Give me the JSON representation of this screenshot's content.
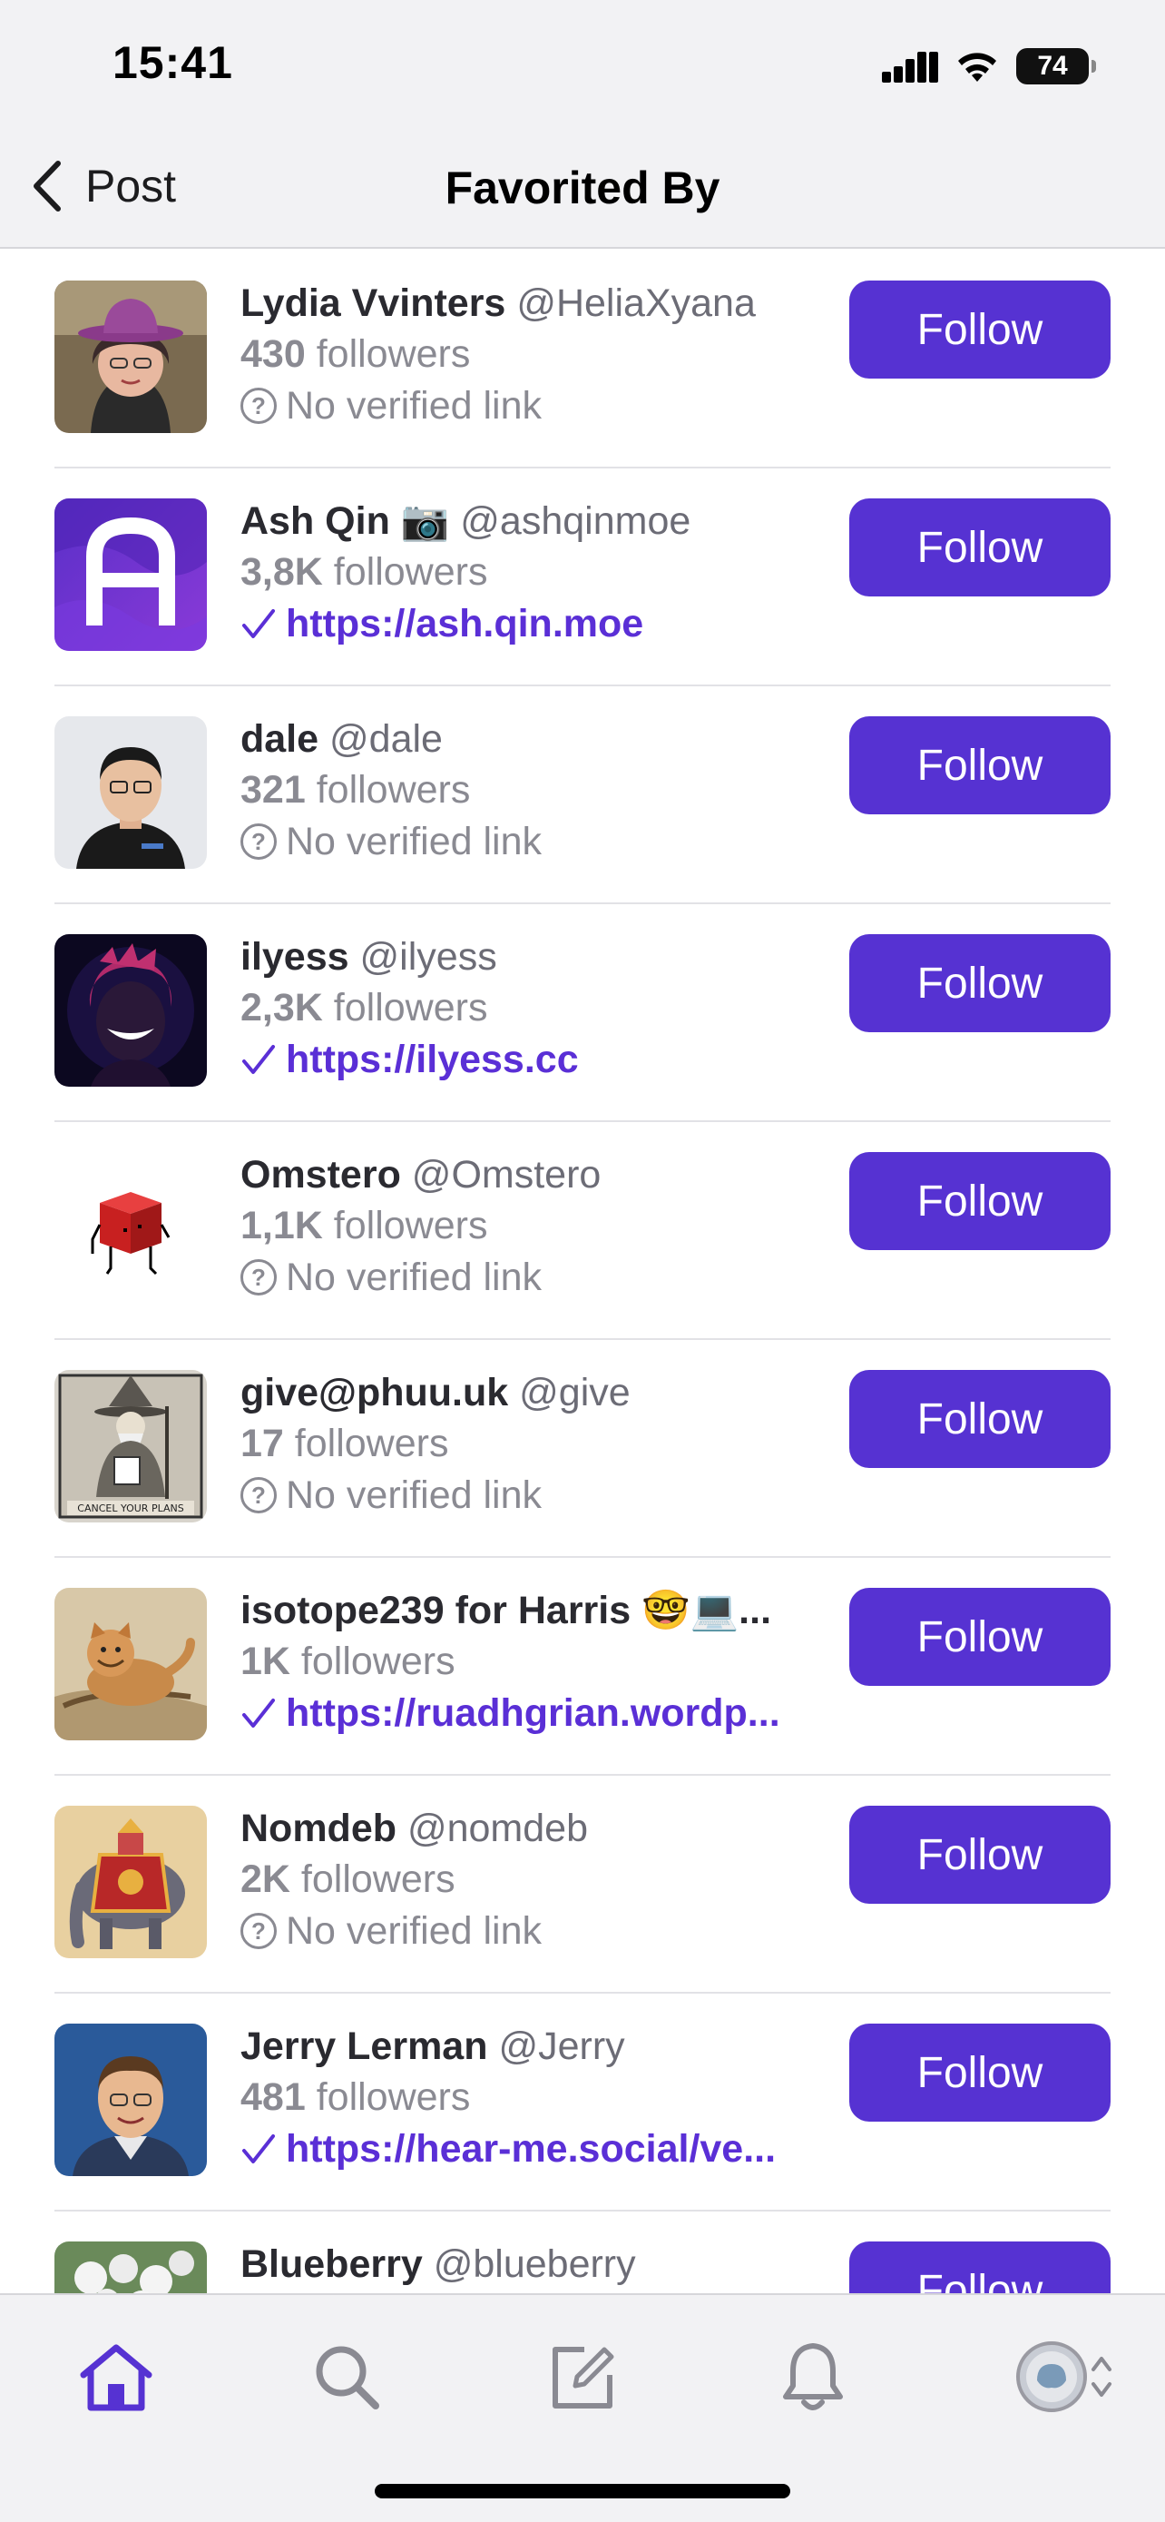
{
  "status_bar": {
    "time": "15:41",
    "battery": "74"
  },
  "nav": {
    "back_label": "Post",
    "title": "Favorited By"
  },
  "follow_label": "Follow",
  "followers_suffix": "followers",
  "users": [
    {
      "name": "Lydia Vvinters",
      "handle": "@HeliaXyana",
      "followers": "430",
      "link": "No verified link",
      "verified": false
    },
    {
      "name": "Ash Qin 📷",
      "handle": "@ashqinmoe",
      "followers": "3,8K",
      "link": "https://ash.qin.moe",
      "verified": true
    },
    {
      "name": "dale",
      "handle": "@dale",
      "followers": "321",
      "link": "No verified link",
      "verified": false
    },
    {
      "name": "ilyess",
      "handle": "@ilyess",
      "followers": "2,3K",
      "link": "https://ilyess.cc",
      "verified": true
    },
    {
      "name": "Omstero",
      "handle": "@Omstero",
      "followers": "1,1K",
      "link": "No verified link",
      "verified": false
    },
    {
      "name": "give@phuu.uk",
      "handle": "@give",
      "followers": "17",
      "link": "No verified link",
      "verified": false
    },
    {
      "name": "isotope239 for Harris 🤓💻...",
      "handle": "",
      "followers": "1K",
      "link": "https://ruadhgrian.wordp...",
      "verified": true
    },
    {
      "name": "Nomdeb",
      "handle": "@nomdeb",
      "followers": "2K",
      "link": "No verified link",
      "verified": false
    },
    {
      "name": "Jerry Lerman",
      "handle": "@Jerry",
      "followers": "481",
      "link": "https://hear-me.social/ve...",
      "verified": true
    },
    {
      "name": "Blueberry",
      "handle": "@blueberry",
      "followers": "",
      "link": "",
      "verified": false
    }
  ],
  "avatar_art": {
    "cancel_caption": "CANCEL YOUR PLANS"
  },
  "tabs": [
    "home-icon",
    "search-icon",
    "compose-icon",
    "notifications-icon",
    "profile-avatar"
  ],
  "colors": {
    "accent": "#5632d2",
    "link": "#5a2fd6",
    "muted": "#8a8a92"
  }
}
